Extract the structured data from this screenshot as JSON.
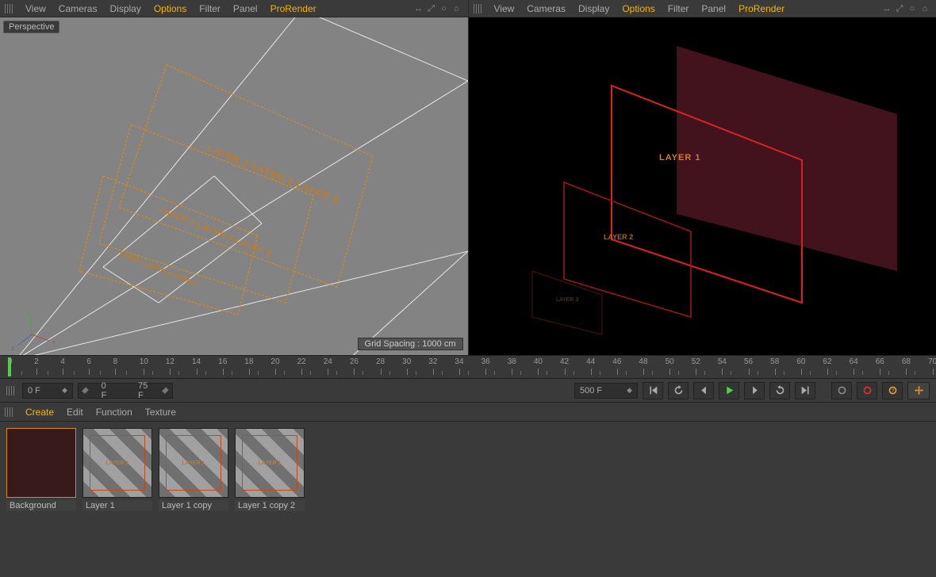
{
  "viewport_menus": {
    "items": [
      "View",
      "Cameras",
      "Display",
      "Options",
      "Filter",
      "Panel",
      "ProRender"
    ],
    "active_left": [
      3,
      6
    ],
    "active_right": [
      3,
      6
    ],
    "corner_icons": [
      "↔",
      "⤢",
      "○",
      "⌂"
    ]
  },
  "left_viewport": {
    "mode_label": "Perspective",
    "grid_spacing_label": "Grid Spacing : 1000 cm",
    "plane_labels": [
      "LAYER 1",
      "LAYER 2",
      "LAYER 3"
    ],
    "axis": {
      "x": "#b54a4a",
      "y": "#4aa04a",
      "z": "#4a6ab5"
    }
  },
  "right_viewport": {
    "plane_labels": [
      "LAYER 1",
      "LAYER 2",
      "LAYER 3"
    ]
  },
  "timeline": {
    "start": 0,
    "end": 70,
    "major_step": 2,
    "cursor_frame": 0
  },
  "playback": {
    "current_frame_label": "0 F",
    "range_start": "0 F",
    "range_end": "75 F",
    "total_label": "500 F",
    "buttons": [
      "goto-start",
      "loop",
      "prev-frame",
      "play",
      "next-frame",
      "redo",
      "goto-end"
    ]
  },
  "materials": {
    "menu": [
      "Create",
      "Edit",
      "Function",
      "Texture"
    ],
    "menu_active": 0,
    "slots": [
      {
        "name": "Background",
        "bg": "#391a1a",
        "has_stripes": false,
        "text": ""
      },
      {
        "name": "Layer 1",
        "bg": "",
        "has_stripes": true,
        "text": "LAYER 1"
      },
      {
        "name": "Layer 1 copy",
        "bg": "",
        "has_stripes": true,
        "text": "LAYER 1"
      },
      {
        "name": "Layer 1 copy 2",
        "bg": "",
        "has_stripes": true,
        "text": "LAYER 1"
      }
    ]
  }
}
